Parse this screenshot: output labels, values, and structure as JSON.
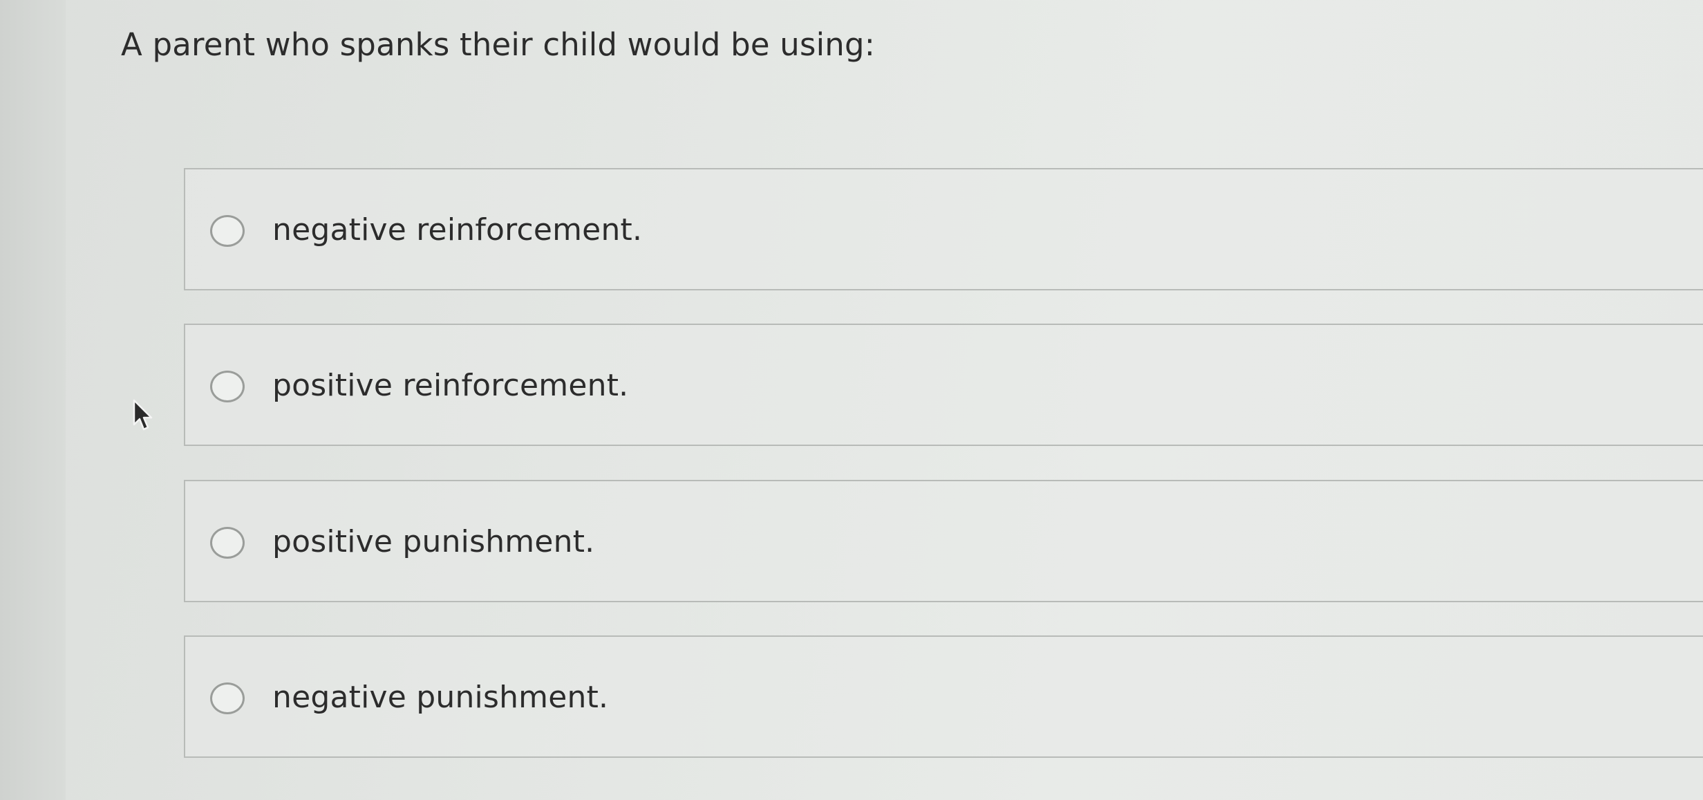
{
  "question": {
    "text": "A parent who spanks their child would be using:"
  },
  "options": [
    {
      "label": "negative reinforcement.",
      "selected": false
    },
    {
      "label": "positive reinforcement.",
      "selected": false
    },
    {
      "label": "positive punishment.",
      "selected": false
    },
    {
      "label": "negative punishment.",
      "selected": false
    }
  ],
  "icons": {
    "cursor": "arrow-cursor-icon",
    "radio": "radio-unselected-icon"
  }
}
